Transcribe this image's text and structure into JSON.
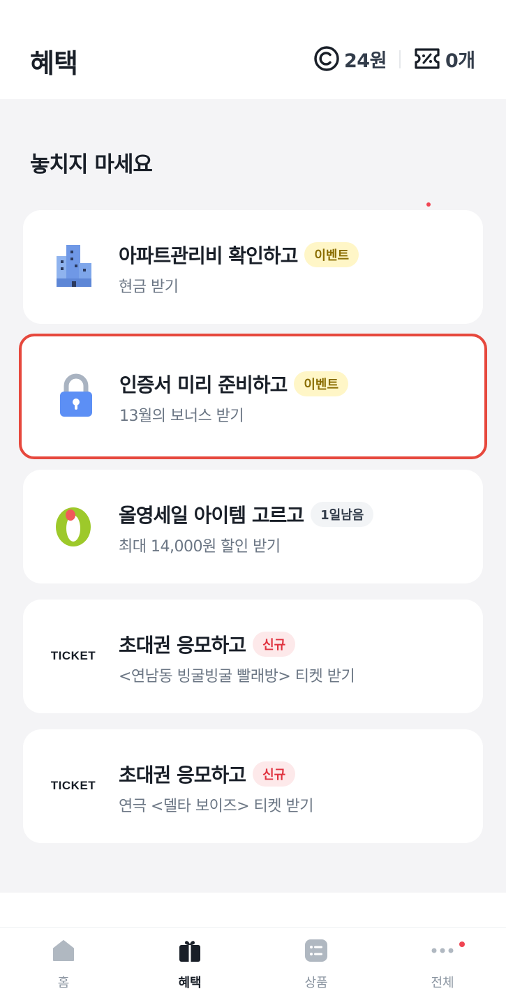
{
  "header": {
    "title": "혜택",
    "points": "24원",
    "coupons": "0개"
  },
  "section": {
    "title": "놓치지 마세요"
  },
  "cards": [
    {
      "title": "아파트관리비 확인하고",
      "badge": "이벤트",
      "subtitle": "현금 받기",
      "icon": "apartment-building-icon"
    },
    {
      "title": "인증서 미리 준비하고",
      "badge": "이벤트",
      "subtitle": "13월의 보너스 받기",
      "icon": "lock-icon"
    },
    {
      "title": "올영세일 아이템 고르고",
      "badge": "1일남음",
      "subtitle": "최대 14,000원 할인 받기",
      "icon": "oliveyoung-logo-icon"
    },
    {
      "title": "초대권 응모하고",
      "badge": "신규",
      "subtitle": "<연남동 빙굴빙굴 빨래방> 티켓 받기",
      "icon": "ticket-icon",
      "icon_text": "TICKET"
    },
    {
      "title": "초대권 응모하고",
      "badge": "신규",
      "subtitle": "연극 <델타 보이즈> 티켓 받기",
      "icon": "ticket-icon",
      "icon_text": "TICKET"
    }
  ],
  "nav": {
    "items": [
      {
        "label": "홈",
        "icon": "home-icon"
      },
      {
        "label": "혜택",
        "icon": "gift-icon",
        "active": true
      },
      {
        "label": "상품",
        "icon": "list-icon"
      },
      {
        "label": "전체",
        "icon": "more-icon"
      }
    ]
  },
  "colors": {
    "highlight_border": "#e6483d",
    "event_badge_bg": "#fff6c7",
    "new_badge_bg": "#fde9ea",
    "notification_dot": "#f04452",
    "background": "#f4f4f6"
  }
}
